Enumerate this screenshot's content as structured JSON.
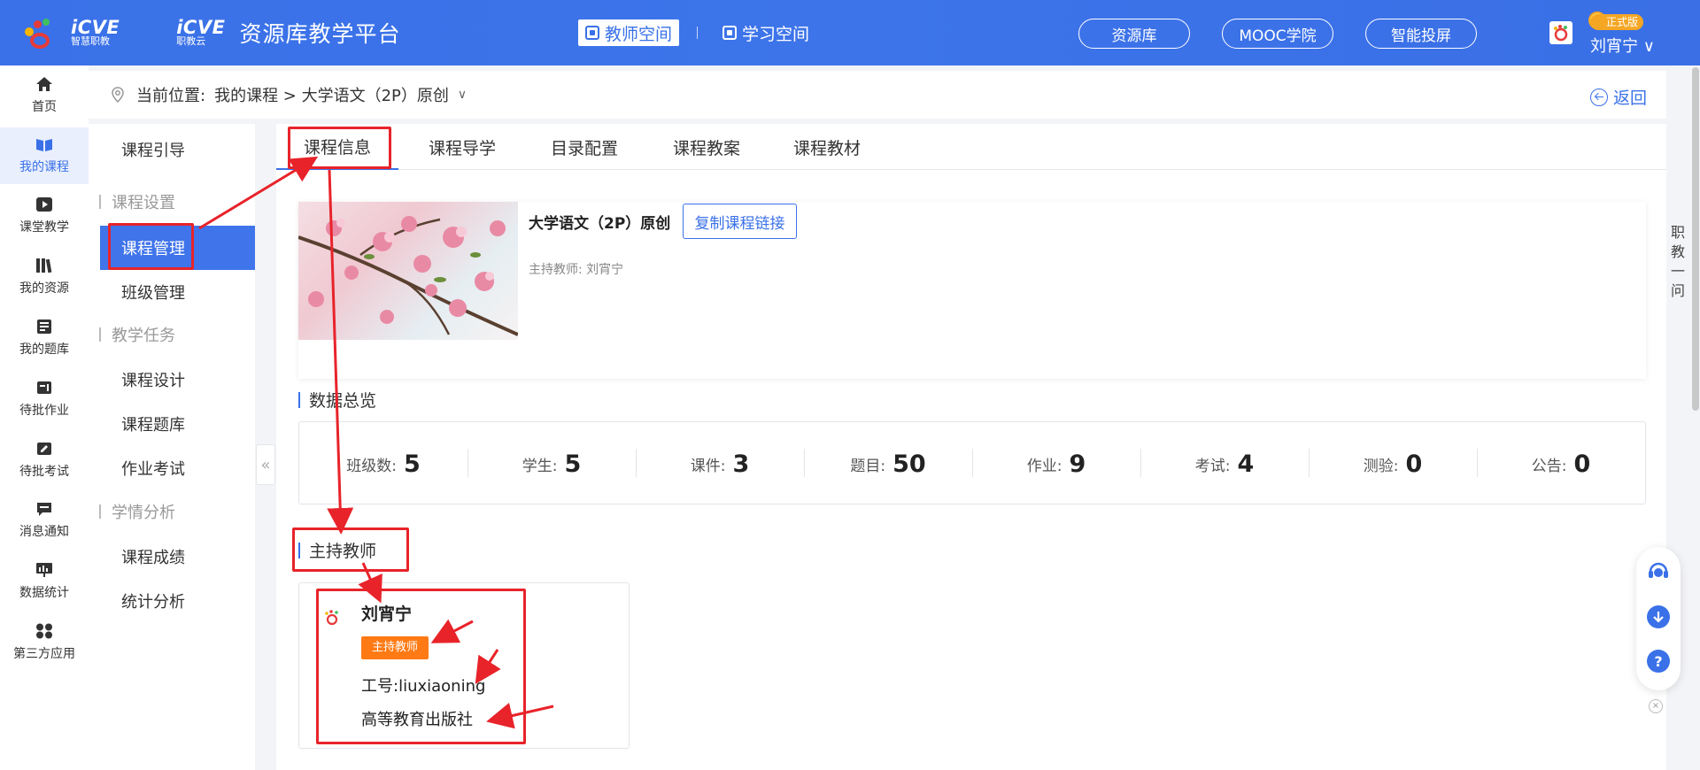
{
  "header": {
    "logo_primary": "iCVE",
    "logo_primary_sub": "智慧职教",
    "logo_secondary": "iCVE",
    "logo_secondary_sub": "职教云",
    "title": "资源库教学平台",
    "spaces": [
      {
        "label": "教师空间",
        "active": true
      },
      {
        "label": "学习空间",
        "active": false
      }
    ],
    "pills": [
      "资源库",
      "MOOC学院",
      "智能投屏"
    ],
    "user_badge": "正式版",
    "user_name": "刘宵宁 ∨"
  },
  "left_nav": [
    {
      "label": "首页",
      "icon": "home-icon"
    },
    {
      "label": "我的课程",
      "icon": "book-icon",
      "active": true
    },
    {
      "label": "课堂教学",
      "icon": "play-icon"
    },
    {
      "label": "我的资源",
      "icon": "library-icon"
    },
    {
      "label": "我的题库",
      "icon": "question-bank-icon"
    },
    {
      "label": "待批作业",
      "icon": "homework-icon"
    },
    {
      "label": "待批考试",
      "icon": "exam-icon"
    },
    {
      "label": "消息通知",
      "icon": "message-icon"
    },
    {
      "label": "数据统计",
      "icon": "chart-icon"
    },
    {
      "label": "第三方应用",
      "icon": "apps-icon"
    }
  ],
  "breadcrumb": {
    "prefix": "当前位置:",
    "path": "我的课程 > 大学语文（2P）原创",
    "back": "返回"
  },
  "sub_sidebar": {
    "guide": "课程引导",
    "group_settings": "课程设置",
    "course_manage": "课程管理",
    "class_manage": "班级管理",
    "group_tasks": "教学任务",
    "course_design": "课程设计",
    "question_bank": "课程题库",
    "homework_exam": "作业考试",
    "group_analysis": "学情分析",
    "grades": "课程成绩",
    "stats": "统计分析"
  },
  "tabs": [
    "课程信息",
    "课程导学",
    "目录配置",
    "课程教案",
    "课程教材"
  ],
  "course": {
    "name": "大学语文（2P）原创",
    "copy_link": "复制课程链接",
    "host": "主持教师: 刘宵宁"
  },
  "overview": {
    "title": "数据总览",
    "stats": [
      {
        "label": "班级数:",
        "value": "5"
      },
      {
        "label": "学生:",
        "value": "5"
      },
      {
        "label": "课件:",
        "value": "3"
      },
      {
        "label": "题目:",
        "value": "50"
      },
      {
        "label": "作业:",
        "value": "9"
      },
      {
        "label": "考试:",
        "value": "4"
      },
      {
        "label": "测验:",
        "value": "0"
      },
      {
        "label": "公告:",
        "value": "0"
      }
    ]
  },
  "host_teacher": {
    "title": "主持教师",
    "name": "刘宵宁",
    "tag": "主持教师",
    "id": "工号:liuxiaoning",
    "org": "高等教育出版社"
  },
  "float": {
    "ask": "职教一问",
    "close": "×"
  },
  "colors": {
    "brand": "#3a71e8",
    "annotation": "#e8232a",
    "tag": "#ff7a14"
  }
}
